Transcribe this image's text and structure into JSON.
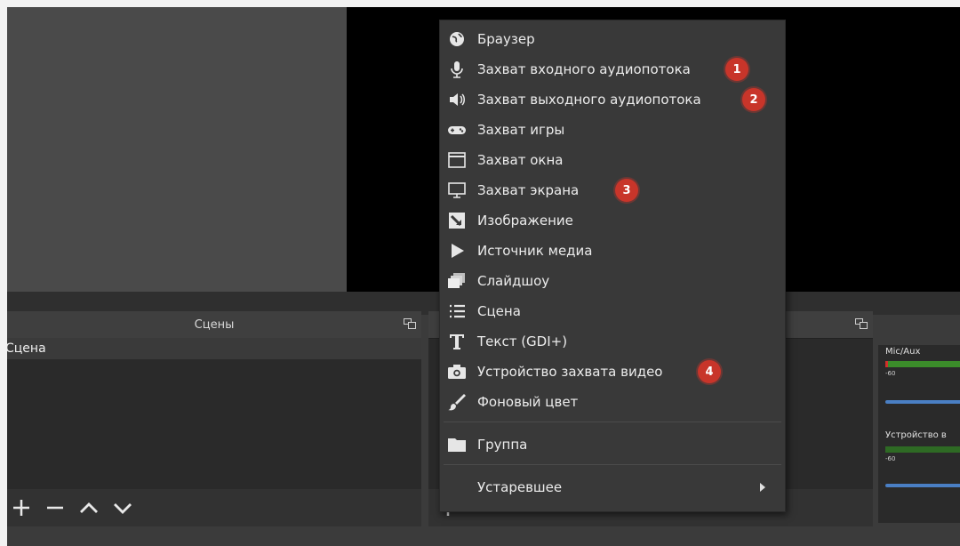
{
  "scenes_panel": {
    "title": "Сцены",
    "items": [
      "Сцена"
    ]
  },
  "mixer": {
    "channels": [
      {
        "name": "Mic/Aux",
        "tick_start": "-60"
      },
      {
        "name": "Устройство в",
        "tick_start": "-60"
      }
    ]
  },
  "context_menu": {
    "items": [
      {
        "label": "Браузер",
        "icon": "globe-icon"
      },
      {
        "label": "Захват входного аудиопотока",
        "icon": "microphone-icon",
        "badge": "1"
      },
      {
        "label": "Захват выходного аудиопотока",
        "icon": "speaker-icon",
        "badge": "2"
      },
      {
        "label": "Захват игры",
        "icon": "gamepad-icon"
      },
      {
        "label": "Захват окна",
        "icon": "window-icon"
      },
      {
        "label": "Захват экрана",
        "icon": "monitor-icon",
        "badge": "3"
      },
      {
        "label": "Изображение",
        "icon": "image-icon"
      },
      {
        "label": "Источник медиа",
        "icon": "play-icon"
      },
      {
        "label": "Слайдшоу",
        "icon": "slideshow-icon"
      },
      {
        "label": "Сцена",
        "icon": "list-icon"
      },
      {
        "label": "Текст (GDI+)",
        "icon": "text-icon"
      },
      {
        "label": "Устройство захвата видео",
        "icon": "camera-icon",
        "badge": "4"
      },
      {
        "label": "Фоновый цвет",
        "icon": "brush-icon"
      },
      {
        "label": "Группа",
        "icon": "folder-icon"
      },
      {
        "label": "Устаревшее",
        "icon": "",
        "has_submenu": true
      }
    ]
  },
  "colors": {
    "badge": "#c8352a",
    "meter_green": "#3b8c2a",
    "volume_blue": "#4a7fc4",
    "menu_bg": "#393939"
  }
}
